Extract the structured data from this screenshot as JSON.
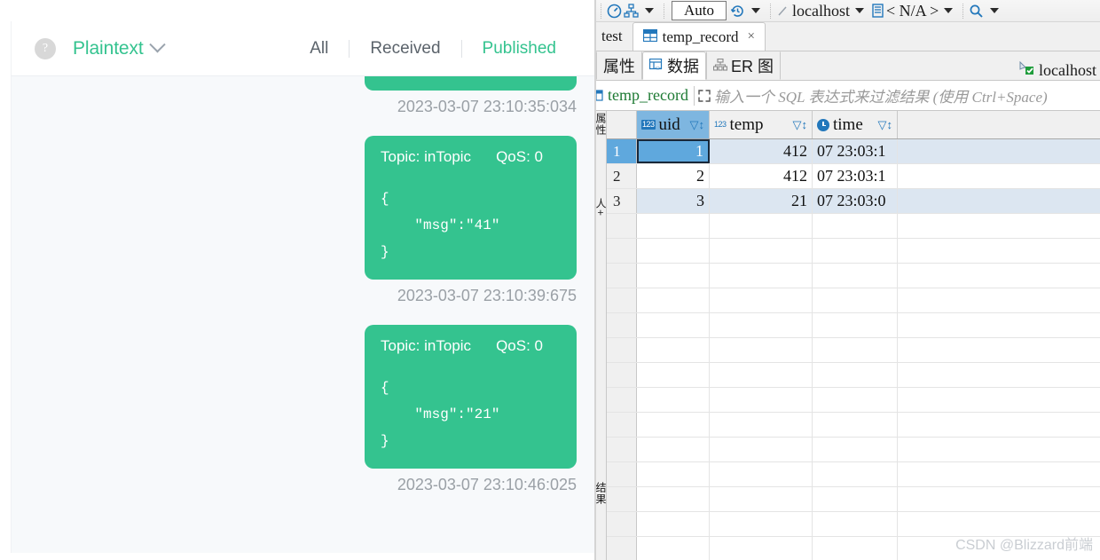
{
  "mqtt": {
    "help_icon": "question-mark-icon",
    "format": {
      "label": "Plaintext",
      "caret": "chevron-down-icon"
    },
    "filters": [
      {
        "label": "All",
        "active": false
      },
      {
        "label": "Received",
        "active": false
      },
      {
        "label": "Published",
        "active": true
      }
    ],
    "messages": [
      {
        "clipped": true,
        "topic_label": "",
        "qos_label": "",
        "payload": "",
        "timestamp": "2023-03-07 23:10:35:034"
      },
      {
        "clipped": false,
        "topic_label": "Topic: inTopic",
        "qos_label": "QoS: 0",
        "payload": "{\n    \"msg\":\"41\"\n}",
        "timestamp": "2023-03-07 23:10:39:675"
      },
      {
        "clipped": false,
        "topic_label": "Topic: inTopic",
        "qos_label": "QoS: 0",
        "payload": "{\n    \"msg\":\"21\"\n}",
        "timestamp": "2023-03-07 23:10:46:025"
      }
    ],
    "accent_color": "#34c38f"
  },
  "db": {
    "toolbar": {
      "dashboard_icon": "gauge-icon",
      "transaction_icon": "transaction-icon",
      "commit_mode": "Auto",
      "history_icon": "history-clock-icon",
      "connection_icon": "plug-icon",
      "connection_name": "localhost",
      "schema_icon": "database-schema-icon",
      "schema_name": "< N/A >",
      "search_icon": "search-icon"
    },
    "editor_tabs": [
      {
        "label": "test",
        "active": false,
        "icon": "",
        "closable": false
      },
      {
        "label": "temp_record",
        "active": true,
        "icon": "table-icon",
        "closable": true
      }
    ],
    "close_glyph": "×",
    "sub_tabs": [
      {
        "label": "属性",
        "active": false,
        "icon": ""
      },
      {
        "label": "数据",
        "active": true,
        "icon": "data-grid-icon"
      },
      {
        "label": "ER 图",
        "active": false,
        "icon": "er-diagram-icon"
      }
    ],
    "connection_badge": {
      "icon": "connection-ok-icon",
      "label": "localhost"
    },
    "filter_bar": {
      "table_name": "temp_record",
      "expand_icon": "expand-icon",
      "placeholder": "输入一个 SQL 表达式来过滤结果 (使用 Ctrl+Space)"
    },
    "rail_labels": [
      "属性",
      "人+",
      "结果"
    ],
    "grid": {
      "columns": [
        {
          "name": "uid",
          "type_badge": "123",
          "is_key": true,
          "selected": true,
          "filter_icon": "column-filter-icon"
        },
        {
          "name": "temp",
          "type_badge": "123",
          "is_key": false,
          "selected": false,
          "filter_icon": "column-filter-icon"
        },
        {
          "name": "time",
          "type_badge": "clock",
          "is_key": false,
          "selected": false,
          "filter_icon": "column-filter-icon"
        }
      ],
      "rows": [
        {
          "num": "1",
          "uid": "1",
          "temp": "412",
          "time": "07 23:03:1",
          "selected": true
        },
        {
          "num": "2",
          "uid": "2",
          "temp": "412",
          "time": "07 23:03:1",
          "selected": false
        },
        {
          "num": "3",
          "uid": "3",
          "temp": "21",
          "time": "07 23:03:0",
          "selected": false
        }
      ],
      "empty_row_count": 14
    },
    "watermark": "CSDN @Blizzard前端"
  }
}
